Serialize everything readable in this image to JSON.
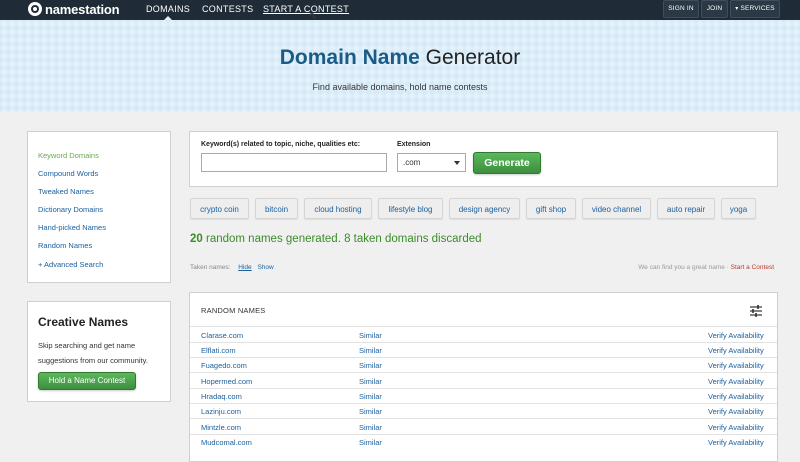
{
  "brand": {
    "name": "namestation"
  },
  "nav": {
    "items": [
      {
        "label": "DOMAINS"
      },
      {
        "label": "CONTESTS"
      },
      {
        "label": "START A CONTEST"
      }
    ],
    "signin": "SIGN IN",
    "join": "JOIN",
    "services": "SERVICES"
  },
  "hero": {
    "title_bold": "Domain Name",
    "title_rest": "Generator",
    "subtitle": "Find available domains, hold name contests"
  },
  "sidebar": {
    "items": [
      {
        "label": "Keyword Domains"
      },
      {
        "label": "Compound Words"
      },
      {
        "label": "Tweaked Names"
      },
      {
        "label": "Dictionary Domains"
      },
      {
        "label": "Hand-picked Names"
      },
      {
        "label": "Random Names"
      },
      {
        "label": "+ Advanced Search"
      }
    ],
    "creative": {
      "title": "Creative Names",
      "text": "Skip searching and get name suggestions from our community.",
      "button": "Hold a Name Contest"
    }
  },
  "search": {
    "keyword_label": "Keyword(s) related to topic, niche, qualities etc:",
    "keyword_value": "",
    "extension_label": "Extension",
    "extension_value": ".com",
    "generate": "Generate"
  },
  "chips": [
    "crypto coin",
    "bitcoin",
    "cloud hosting",
    "lifestyle blog",
    "design agency",
    "gift shop",
    "video channel",
    "auto repair",
    "yoga"
  ],
  "results": {
    "count": "20",
    "text": "random names generated. 8 taken domains discarded",
    "taken_label": "Taken names:",
    "hide": "Hide",
    "show": "Show",
    "find_text": "We can find you a great name ·",
    "find_link": "Start a Contest"
  },
  "names": {
    "header": "RANDOM NAMES",
    "similar_label": "Similar",
    "verify_label": "Verify Availability",
    "rows": [
      "Clarase.com",
      "Elflati.com",
      "Fuagedo.com",
      "Hopermed.com",
      "Hradaq.com",
      "Lazinju.com",
      "Mintzle.com",
      "Mudcomal.com"
    ]
  },
  "colors": {
    "topbar": "#1f2c37",
    "link": "#1a5f9c",
    "green": "#3a8d28",
    "hero_bg": "#e3f1fb"
  }
}
